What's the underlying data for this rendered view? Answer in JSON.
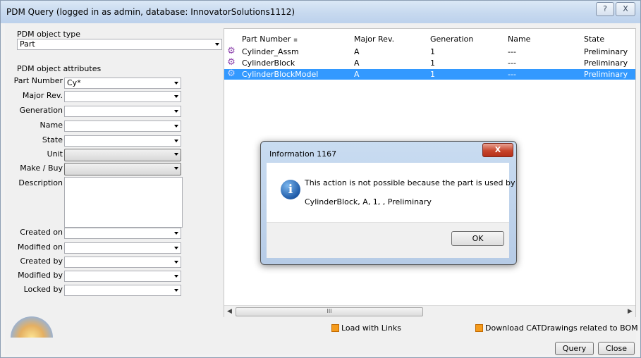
{
  "window": {
    "title": "PDM Query (logged in as admin, database: InnovatorSolutions1112)",
    "help_icon": "?",
    "close_icon": "X"
  },
  "left": {
    "object_type_label": "PDM object type",
    "object_type_value": "Part",
    "attributes_label": "PDM object attributes",
    "fields": [
      {
        "label": "Part Number",
        "value": "Cy*"
      },
      {
        "label": "Major Rev.",
        "value": ""
      },
      {
        "label": "Generation",
        "value": ""
      },
      {
        "label": "Name",
        "value": ""
      },
      {
        "label": "State",
        "value": ""
      },
      {
        "label": "Unit",
        "value": ""
      },
      {
        "label": "Make / Buy",
        "value": ""
      },
      {
        "label": "Description",
        "value": ""
      },
      {
        "label": "Created on",
        "value": ""
      },
      {
        "label": "Modified on",
        "value": ""
      },
      {
        "label": "Created by",
        "value": ""
      },
      {
        "label": "Modified by",
        "value": ""
      },
      {
        "label": "Locked by",
        "value": ""
      }
    ]
  },
  "results": {
    "columns": [
      "Part Number",
      "Major Rev.",
      "Generation",
      "Name",
      "State"
    ],
    "rows": [
      {
        "part": "Cylinder_Assm",
        "rev": "A",
        "gen": "1",
        "name": "---",
        "state": "Preliminary",
        "icon": "gear-assembly-icon"
      },
      {
        "part": "CylinderBlock",
        "rev": "A",
        "gen": "1",
        "name": "---",
        "state": "Preliminary",
        "icon": "gear-assembly-icon"
      },
      {
        "part": "CylinderBlockModel",
        "rev": "A",
        "gen": "1",
        "name": "---",
        "state": "Preliminary",
        "icon": "gear-assembly-icon"
      }
    ],
    "scroll_thumb_text": "III"
  },
  "options": {
    "load_links": "Load with Links",
    "download_drawings": "Download CATDrawings related to BOM Part"
  },
  "buttons": {
    "query": "Query",
    "close": "Close"
  },
  "dialog": {
    "title": "Information 1167",
    "close_icon": "X",
    "info_icon": "i",
    "line1": "This action is not possible because the part is used by",
    "line2": "CylinderBlock, A, 1, , Preliminary",
    "ok": "OK"
  }
}
